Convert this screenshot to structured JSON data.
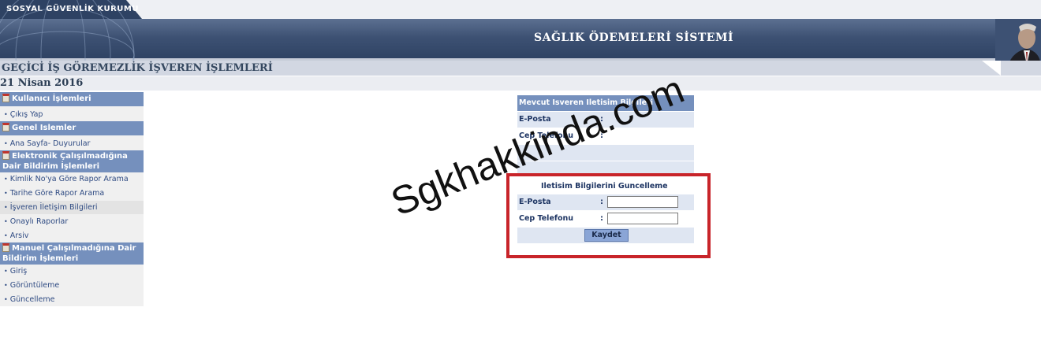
{
  "header": {
    "organization": "SOSYAL GÜVENLİK KURUMU",
    "system_title": "SAĞLIK ÖDEMELERİ SİSTEMİ",
    "page_title": "GEÇİCİ İŞ GÖREMEZLİK İŞVEREN İŞLEMLERİ",
    "date": "21 Nisan 2016"
  },
  "sidebar": {
    "sections": [
      {
        "title": "Kullanıcı İşlemleri",
        "items": [
          "Çıkış Yap"
        ]
      },
      {
        "title": "Genel Islemler",
        "items": [
          "Ana Sayfa- Duyurular"
        ]
      },
      {
        "title_line1": "Elektronik Çalışılmadığına",
        "title_line2": "Dair Bildirim İşlemleri",
        "items": [
          "Kimlik No'ya Göre Rapor Arama",
          "Tarihe Göre Rapor Arama",
          "İşveren İletişim Bilgileri",
          "Onaylı Raporlar",
          "Arsiv"
        ]
      },
      {
        "title_line1": "Manuel Çalışılmadığına Dair",
        "title_line2": "Bildirim İşlemleri",
        "items": [
          "Giriş",
          "Görüntüleme",
          "Güncelleme"
        ]
      }
    ],
    "active_item": "İşveren İletişim Bilgileri"
  },
  "current_info": {
    "heading": "Mevcut Isveren Iletisim Bilgileri",
    "email_label": "E-Posta",
    "phone_label": "Cep Telefonu",
    "separator": ":"
  },
  "update_form": {
    "heading": "Iletisim Bilgilerini Guncelleme",
    "email_label": "E-Posta",
    "phone_label": "Cep Telefonu",
    "email_value": "",
    "phone_value": "",
    "separator": ":",
    "save_label": "Kaydet"
  },
  "watermark": "Sgkhakkinda.com",
  "colors": {
    "banner": "#3d5173",
    "section_header": "#7590bd",
    "highlight": "#c8242a",
    "row_background": "#dfe6f2"
  }
}
